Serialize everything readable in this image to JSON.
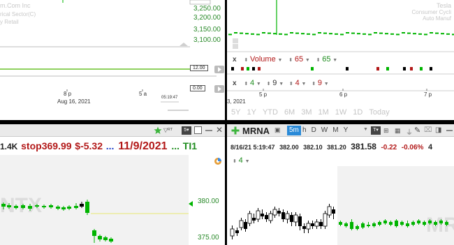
{
  "colors": {
    "up": "#00b400",
    "down": "#000000",
    "accent_red": "#b21818",
    "accent_green": "#1e8c1e",
    "watermark": "#c8c8c8"
  },
  "top_left": {
    "watermark_lines": [
      "m.Com Inc",
      "rical Sector(C)",
      "y Retail"
    ],
    "price_axis": [
      "3,250.00",
      "3,200.00",
      "3,150.00",
      "3,100.00"
    ],
    "sub_value_1": "12.00",
    "sub_value_2": "0.00",
    "time_labels": {
      "t1": "8 p",
      "t1_date": "Aug 16, 2021",
      "t2": "5 a",
      "t2_small": "05:19:47"
    }
  },
  "top_right": {
    "watermark_lines": [
      "Tesla",
      "Consumer Cycli",
      "Auto Manuf"
    ],
    "indicator_row_1": {
      "close": "x",
      "name": "Volume",
      "p1": "65",
      "p2": "65"
    },
    "indicator_row_2": {
      "close": "x",
      "v1": "4",
      "v2": "9",
      "v3": "4",
      "v4": "9"
    },
    "time_labels": [
      "5 p",
      "6 p",
      "7 p"
    ],
    "date_frag": "3, 2021",
    "periods": [
      "5Y",
      "1Y",
      "YTD",
      "6M",
      "3M",
      "1M",
      "1W",
      "1D",
      "Today"
    ]
  },
  "bottom_left": {
    "ticker_line": {
      "vol": "1.4K",
      "stop": "stop369.99",
      "change": "$-5.32",
      "dots": "...",
      "date": "11/9/2021",
      "more": "...",
      "tail": "TI1"
    },
    "watermark": "NTX",
    "price_axis": [
      "380.00",
      "375.00"
    ]
  },
  "bottom_right": {
    "symbol": "MRNA",
    "interval": "5m",
    "intervals": [
      "h",
      "D",
      "W",
      "M",
      "Y"
    ],
    "quote": {
      "datetime": "8/16/21 5:19:47",
      "open": "382.00",
      "high": "382.10",
      "low": "381.20",
      "last": "381.58",
      "change": "-0.22",
      "pct": "-0.06%",
      "extra": "4"
    },
    "indicator": "4",
    "watermark": "MR"
  }
}
